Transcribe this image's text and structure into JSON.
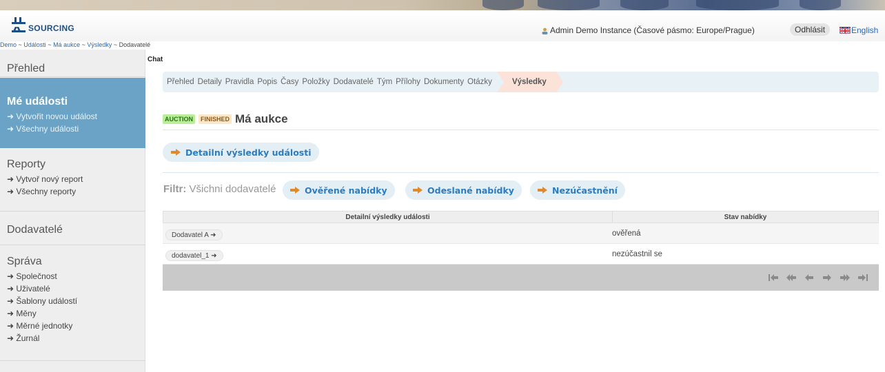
{
  "header": {
    "logo_text": "SOURCING",
    "user_info": "Admin Demo Instance (Časové pásmo: Europe/Prague)",
    "logout_label": "Odhlásit",
    "language_label": "English"
  },
  "breadcrumb": {
    "items": [
      "Demo",
      "Události",
      "Má aukce",
      "Výsledky"
    ],
    "separator": " ~ ",
    "current": "Dodavatelé"
  },
  "sidebar": {
    "overview": "Přehled",
    "my_events": {
      "title": "Mé události",
      "links": [
        "Vytvořit novou událost",
        "Všechny události"
      ]
    },
    "reports": {
      "title": "Reporty",
      "links": [
        "Vytvoř nový report",
        "Všechny reporty"
      ]
    },
    "suppliers": "Dodavatelé",
    "admin": {
      "title": "Správa",
      "links": [
        "Společnost",
        "Uživatelé",
        "Šablony událostí",
        "Měny",
        "Měrné jednotky",
        "Žurnál"
      ]
    }
  },
  "chat_label": "Chat",
  "tabs": [
    "Přehled",
    "Detaily",
    "Pravidla",
    "Popis",
    "Časy",
    "Položky",
    "Dodavatelé",
    "Tým",
    "Přílohy",
    "Dokumenty",
    "Otázky"
  ],
  "active_tab": "Výsledky",
  "event": {
    "type_badge": "AUCTION",
    "status_badge": "FINISHED",
    "title": "Má aukce"
  },
  "detail_button": "Detailní výsledky události",
  "filter": {
    "label": "Filtr:",
    "current": "Všichni dodavatelé",
    "options": [
      "Ověřené nabídky",
      "Odeslané nabídky",
      "Nezúčastnění"
    ]
  },
  "table": {
    "headers": [
      "Detailní výsledky události",
      "Stav nabídky"
    ],
    "rows": [
      {
        "supplier": "Dodavatel A",
        "status": "ověřená"
      },
      {
        "supplier": "dodavatel_1",
        "status": "nezúčastnil se"
      }
    ]
  },
  "pager": [
    "first-page-icon",
    "prev-fast-icon",
    "prev-page-icon",
    "next-page-icon",
    "next-fast-icon",
    "last-page-icon"
  ],
  "colors": {
    "accent": "#2c7dbf",
    "sidebar_active": "#6aa3c6",
    "arrow": "#e08a2c",
    "tab_active": "#fbe3d9"
  }
}
